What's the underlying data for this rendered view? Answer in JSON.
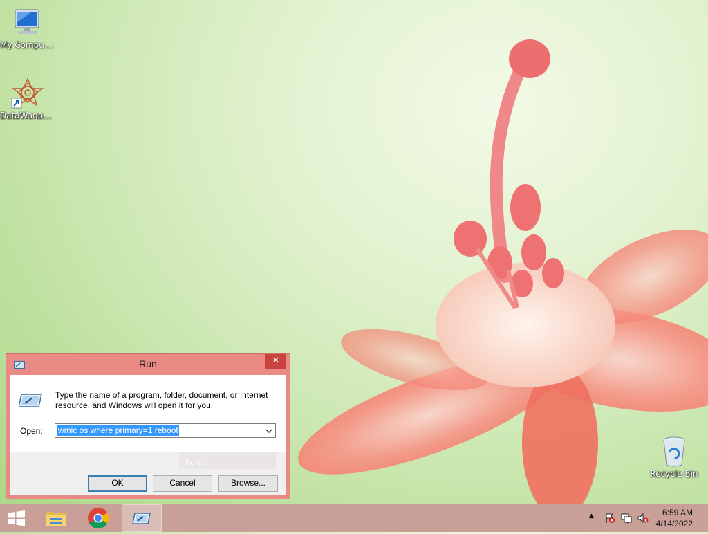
{
  "desktop": {
    "icons": [
      {
        "label": "My Computer",
        "icon": "computer-icon"
      },
      {
        "label": "DataWagon...",
        "icon": "datawagon-shortcut-icon"
      },
      {
        "label": "Recycle Bin",
        "icon": "recycle-bin-icon"
      }
    ]
  },
  "run_dialog": {
    "title": "Run",
    "close_glyph": "✕",
    "description": "Type the name of a program, folder, document, or Internet resource, and Windows will open it for you.",
    "open_label": "Open:",
    "open_value": "wmic os where primary=1 reboot",
    "buttons": {
      "ok": "OK",
      "cancel": "Cancel",
      "browse": "Browse..."
    },
    "ghost_text": "Run..."
  },
  "taskbar": {
    "items": [
      "start-button",
      "file-explorer-icon",
      "chrome-icon",
      "run-taskbar-icon"
    ],
    "tray": [
      "show-hidden-icons-arrow",
      "action-center-flag-icon",
      "network-icon",
      "volume-muted-icon"
    ],
    "tray_arrow": "▲",
    "clock": {
      "time": "6:59 AM",
      "date": "4/14/2022"
    }
  },
  "colors": {
    "dialog_frame": "#e98a84",
    "close_button": "#c9443f",
    "taskbar": "#c8a098",
    "selection": "#3399ff"
  }
}
